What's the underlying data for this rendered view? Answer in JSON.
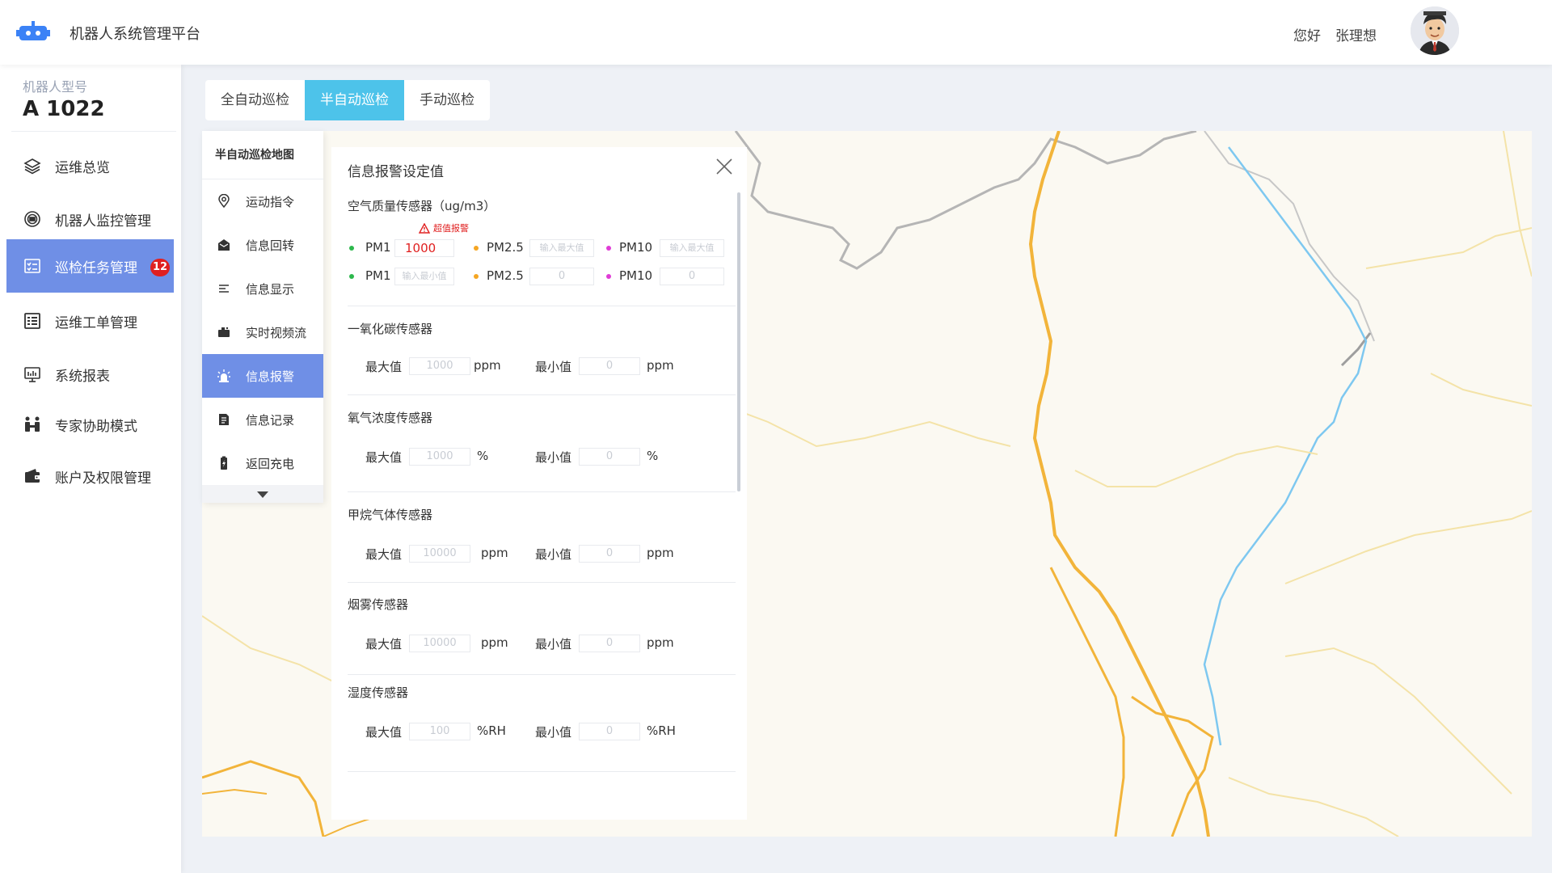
{
  "header": {
    "title": "机器人系统管理平台",
    "greeting": "您好",
    "username": "张理想"
  },
  "sidebar": {
    "model_label": "机器人型号",
    "model_value": "A 1022",
    "items": [
      {
        "label": "运维总览",
        "icon": "layers-icon"
      },
      {
        "label": "机器人监控管理",
        "icon": "robot-monitor-icon"
      },
      {
        "label": "巡检任务管理",
        "icon": "task-list-icon",
        "badge": "12",
        "active": true
      },
      {
        "label": "运维工单管理",
        "icon": "work-order-icon"
      },
      {
        "label": "系统报表",
        "icon": "report-icon"
      },
      {
        "label": "专家协助模式",
        "icon": "expert-icon"
      },
      {
        "label": "账户及权限管理",
        "icon": "wallet-icon"
      }
    ]
  },
  "tabs": [
    {
      "label": "全自动巡检"
    },
    {
      "label": "半自动巡检",
      "active": true
    },
    {
      "label": "手动巡检"
    }
  ],
  "submenu": {
    "title": "半自动巡检地图",
    "items": [
      {
        "label": "运动指令",
        "icon": "location-icon"
      },
      {
        "label": "信息回转",
        "icon": "mail-icon"
      },
      {
        "label": "信息显示",
        "icon": "list-icon"
      },
      {
        "label": "实时视频流",
        "icon": "camera-icon"
      },
      {
        "label": "信息报警",
        "icon": "alarm-icon",
        "active": true
      },
      {
        "label": "信息记录",
        "icon": "note-icon"
      },
      {
        "label": "返回充电",
        "icon": "battery-icon"
      }
    ]
  },
  "panel": {
    "title": "信息报警设定值",
    "air": {
      "title": "空气质量传感器（ug/m3）",
      "warning": "超值报警",
      "max_row": {
        "pm1_label": "PM1",
        "pm1_value": "1000",
        "pm25_label": "PM2.5",
        "pm25_placeholder": "输入最大值",
        "pm10_label": "PM10",
        "pm10_placeholder": "输入最大值"
      },
      "min_row": {
        "pm1_label": "PM1",
        "pm1_placeholder": "输入最小值",
        "pm25_label": "PM2.5",
        "pm25_value": "0",
        "pm10_label": "PM10",
        "pm10_value": "0"
      }
    },
    "max_label": "最大值",
    "min_label": "最小值",
    "sensors": [
      {
        "title": "一氧化碳传感器",
        "max": "1000",
        "min": "0",
        "unit": "ppm"
      },
      {
        "title": "氧气浓度传感器",
        "max": "1000",
        "min": "0",
        "unit": "%"
      },
      {
        "title": "甲烷气体传感器",
        "max": "10000",
        "min": "0",
        "unit": "ppm"
      },
      {
        "title": "烟雾传感器",
        "max": "10000",
        "min": "0",
        "unit": "ppm"
      },
      {
        "title": "湿度传感器",
        "max": "100",
        "min": "0",
        "unit": "%RH"
      }
    ]
  },
  "colors": {
    "accent": "#6f8fe6",
    "tab_active": "#4dc3ea",
    "badge": "#e02020",
    "pm1_dot": "#2db84d",
    "pm25_dot": "#f5a623",
    "pm10_dot": "#e03cd6"
  }
}
